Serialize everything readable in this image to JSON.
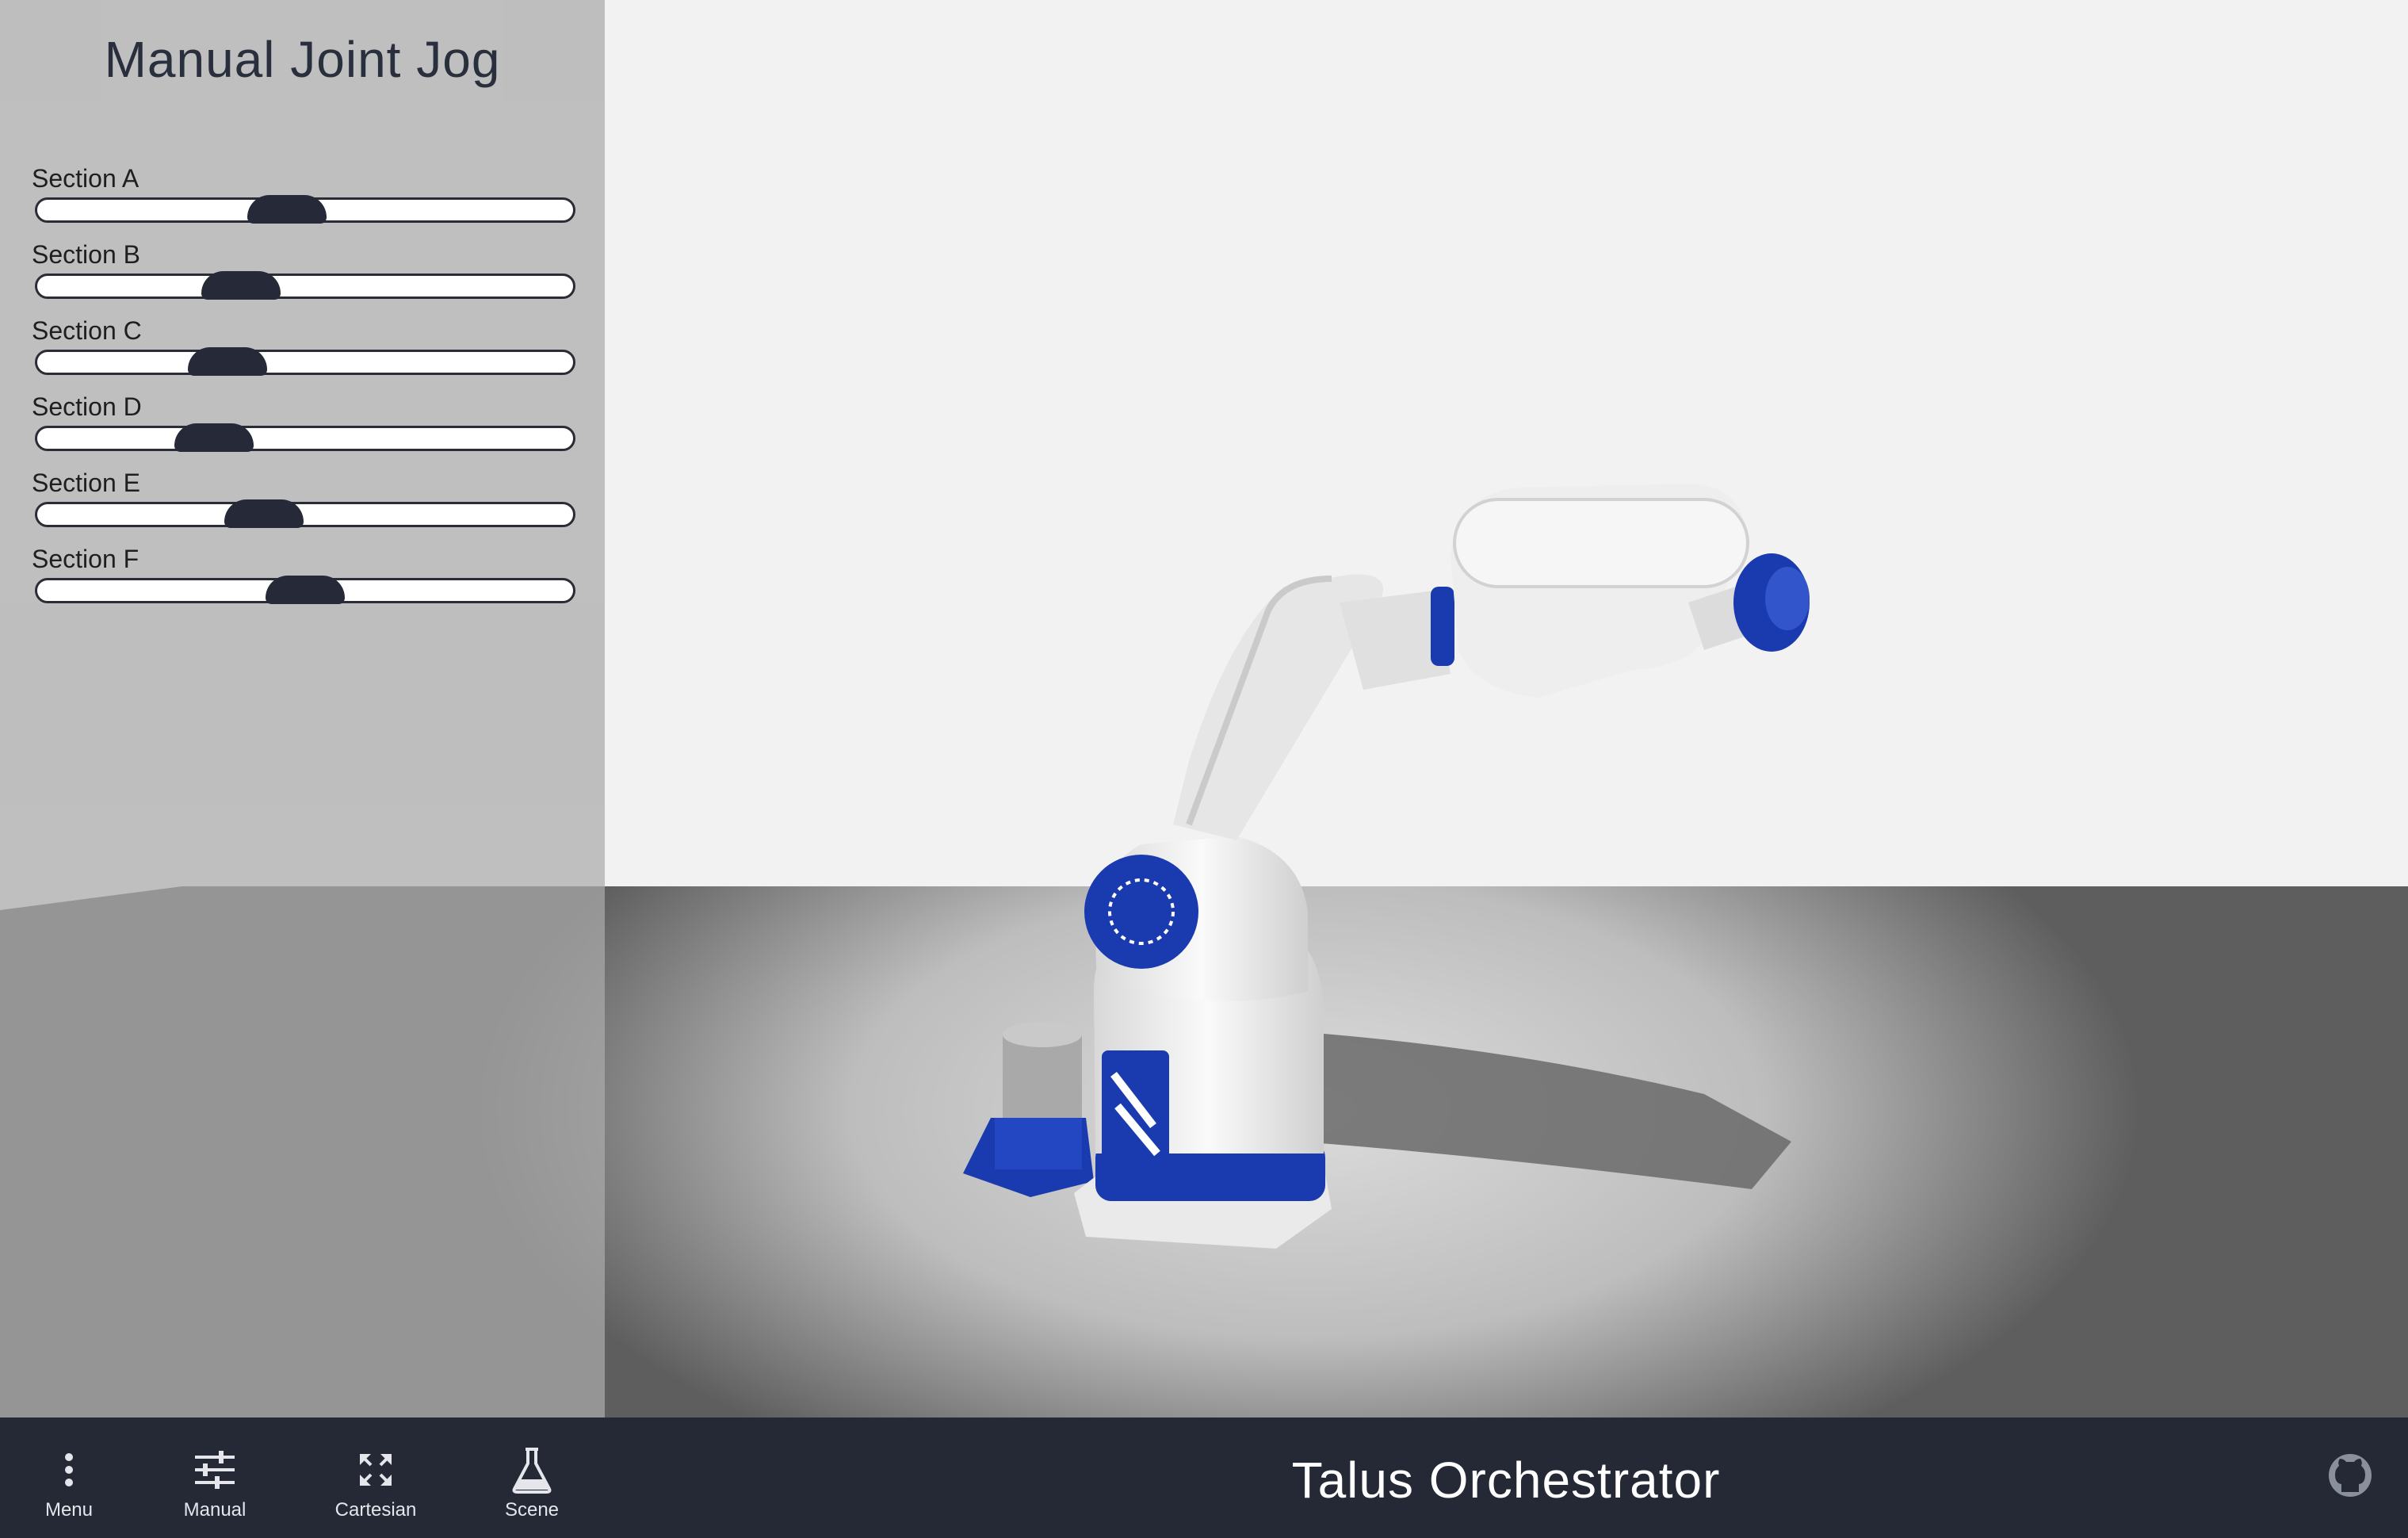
{
  "panel": {
    "title": "Manual Joint Jog",
    "sliders": [
      {
        "label": "Section A",
        "value": 0.46
      },
      {
        "label": "Section B",
        "value": 0.36
      },
      {
        "label": "Section C",
        "value": 0.33
      },
      {
        "label": "Section D",
        "value": 0.3
      },
      {
        "label": "Section E",
        "value": 0.41
      },
      {
        "label": "Section F",
        "value": 0.5
      }
    ]
  },
  "bottombar": {
    "app_title": "Talus Orchestrator",
    "nav": [
      {
        "label": "Menu",
        "icon": "more-vertical-icon"
      },
      {
        "label": "Manual",
        "icon": "sliders-icon"
      },
      {
        "label": "Cartesian",
        "icon": "expand-arrows-icon"
      },
      {
        "label": "Scene",
        "icon": "flask-icon"
      }
    ],
    "github_icon": "github-icon"
  },
  "colors": {
    "accent_blue": "#1a3ab0",
    "bar_bg": "#252936",
    "thumb": "#262a38",
    "panel_text": "#2a2f3d"
  }
}
